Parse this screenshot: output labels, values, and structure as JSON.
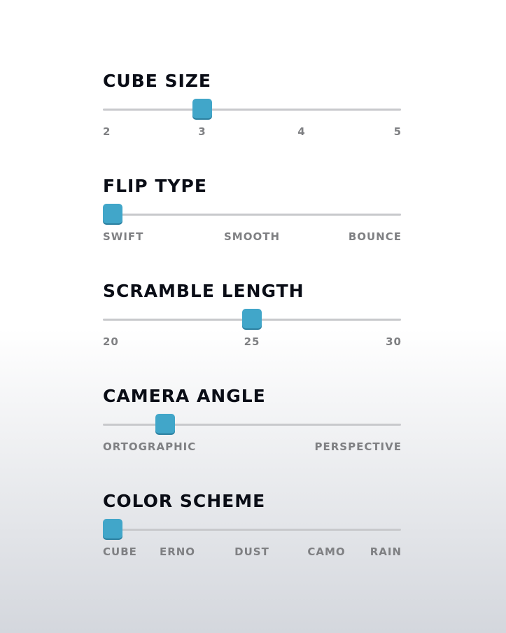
{
  "settings": [
    {
      "title": "Cube Size",
      "options": [
        "2",
        "3",
        "4",
        "5"
      ],
      "selected_index": 1,
      "value": "3"
    },
    {
      "title": "Flip Type",
      "options": [
        "Swift",
        "Smooth",
        "Bounce"
      ],
      "selected_index": 0,
      "value": "Swift"
    },
    {
      "title": "Scramble Length",
      "options": [
        "20",
        "25",
        "30"
      ],
      "selected_index": 1,
      "value": "25"
    },
    {
      "title": "Camera Angle",
      "options": [
        "Ortographic",
        "Perspective"
      ],
      "selected_fraction": 0.21,
      "value": "Ortographic"
    },
    {
      "title": "Color Scheme",
      "options": [
        "Cube",
        "Erno",
        "Dust",
        "Camo",
        "Rain"
      ],
      "selected_index": 0,
      "value": "Cube"
    }
  ],
  "colors": {
    "accent": "#41a6c9",
    "title": "#0a0d16",
    "label": "#7f8083",
    "track": "#c8c9cc"
  }
}
